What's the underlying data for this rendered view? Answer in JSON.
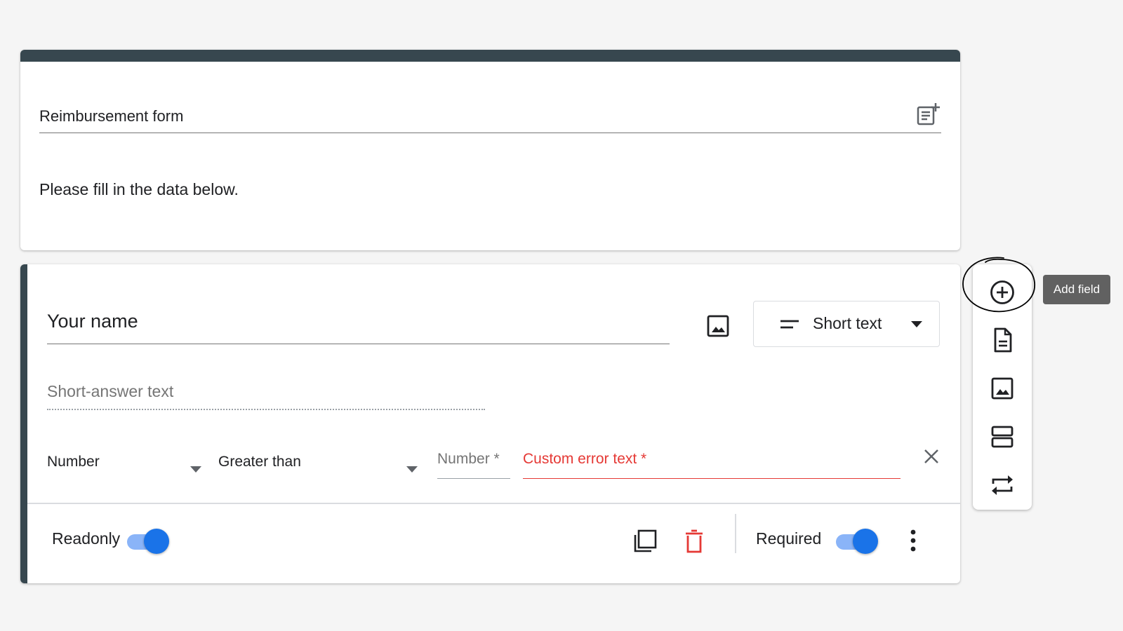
{
  "header": {
    "title": "Reimbursement form",
    "description": "Please fill in the data below."
  },
  "question": {
    "title": "Your name",
    "type_label": "Short text",
    "answer_placeholder": "Short-answer text",
    "validation": {
      "type": "Number",
      "operator": "Greater than",
      "number_placeholder": "Number *",
      "error_placeholder": "Custom error text *"
    },
    "footer": {
      "readonly_label": "Readonly",
      "readonly_on": true,
      "required_label": "Required",
      "required_on": true
    }
  },
  "toolbar": {
    "add_field_tooltip": "Add field"
  },
  "colors": {
    "accent_bar": "#37474f",
    "toggle_on": "#1a73e8",
    "error": "#e53935"
  }
}
